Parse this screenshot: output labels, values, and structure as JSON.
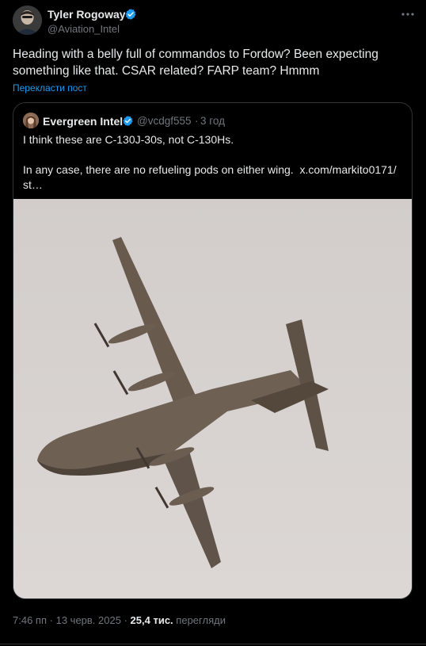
{
  "author": {
    "name": "Tyler Rogoway",
    "handle": "@Aviation_Intel",
    "verified_icon": "verified-badge-icon"
  },
  "tweet": {
    "text_lines": [
      "Heading with a belly full of commandos to Fordow? Been expecting",
      "something like that. CSAR related? FARP team? Hmmm"
    ],
    "translate_label": "Перекласти пост"
  },
  "quote": {
    "name": "Evergreen Intel",
    "handle": "@vcdgf555",
    "separator": "·",
    "time": "3 год",
    "text_line1": "I think these are C-130J-30s, not C-130Hs.",
    "text_line2": "In any case, there are no refueling pods on either wing.",
    "link_text": "x.com/markito0171/",
    "text_line3": "st…"
  },
  "footer": {
    "time": "7:46 пп",
    "separator": "·",
    "date": "13 черв. 2025",
    "views_count": "25,4 тис.",
    "views_label": "перегляди"
  },
  "colors": {
    "background": "#000000",
    "text": "#e7e9ea",
    "secondary": "#71767b",
    "accent": "#1d9bf0",
    "border": "#2f3336"
  }
}
